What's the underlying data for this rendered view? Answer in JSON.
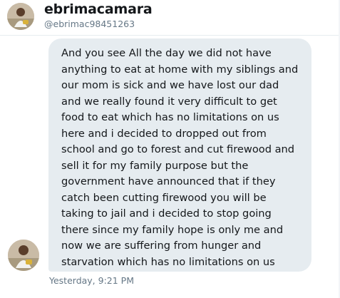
{
  "profile": {
    "display_name": "ebrimacamara",
    "handle": "@ebrimac98451263"
  },
  "message": {
    "text": "And you see All the day we did not have anything to eat at home with my siblings and our mom is sick and we have lost our dad and we really found it very difficult to get food to eat which has no limitations on us here and i decided to dropped out from school and go to forest and cut firewood and sell it for my family purpose but the government have announced that if they catch been cutting firewood you will be taking to jail and i decided to stop going there since my family hope is only me and now we are suffering from hunger and starvation which has no limitations on us here",
    "timestamp": "Yesterday, 9:21 PM"
  },
  "colors": {
    "bubble_background": "#e6ecf0",
    "secondary_text": "#657786",
    "primary_text": "#14171a"
  }
}
